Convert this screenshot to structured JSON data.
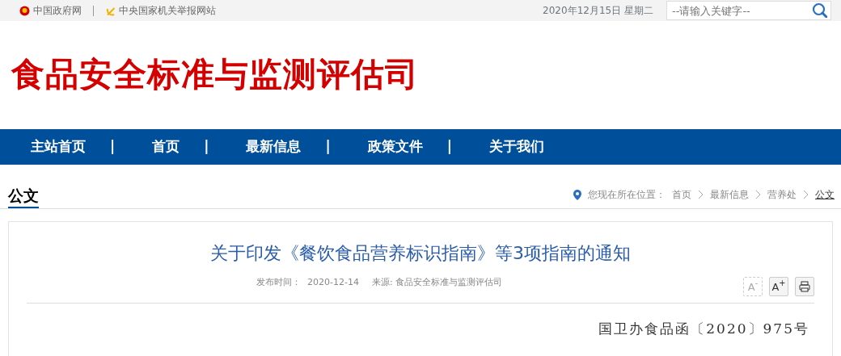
{
  "top_bar": {
    "links": [
      {
        "label": "中国政府网",
        "kind": "emblem"
      },
      {
        "label": "中央国家机关举报网站",
        "kind": "badge"
      }
    ],
    "date": "2020年12月15日 星期二",
    "search": {
      "placeholder": "--请输入关键字--"
    }
  },
  "site_title": "食品安全标准与监测评估司",
  "nav": [
    {
      "kind": "link",
      "label": "主站首页"
    },
    {
      "kind": "separator",
      "label": "|"
    },
    {
      "kind": "link",
      "label": "首页"
    },
    {
      "kind": "separator",
      "label": "|"
    },
    {
      "kind": "link",
      "label": "最新信息"
    },
    {
      "kind": "separator",
      "label": "|"
    },
    {
      "kind": "link",
      "label": "政策文件"
    },
    {
      "kind": "separator",
      "label": "|"
    },
    {
      "kind": "link",
      "label": "关于我们"
    }
  ],
  "section_title": "公文",
  "breadcrumb": {
    "prefix": "您现在所在位置：",
    "items": [
      {
        "label": "首页",
        "current": false
      },
      {
        "label": "最新信息",
        "current": false
      },
      {
        "label": "营养处",
        "current": false
      },
      {
        "label": "公文",
        "current": true
      }
    ]
  },
  "article": {
    "title": "关于印发《餐饮食品营养标识指南》等3项指南的通知",
    "published_label": "发布时间：",
    "published": "2020-12-14",
    "source": "来源: 食品安全标准与监测评估司",
    "tools": [
      {
        "kind": "text",
        "label": "A$^{-}$",
        "disabled": true
      },
      {
        "kind": "text",
        "label": "A$^{+}$",
        "disabled": false
      },
      {
        "kind": "print",
        "disabled": false
      }
    ],
    "doc_number": "国卫办食品函〔2020〕975号"
  }
}
